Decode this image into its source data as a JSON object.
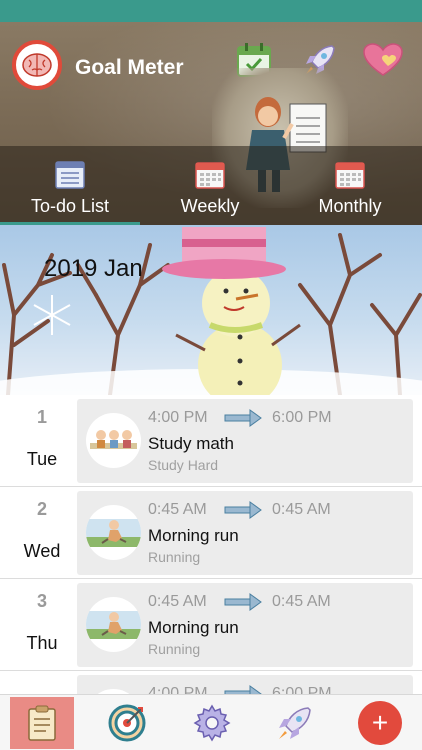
{
  "app": {
    "title": "Goal Meter",
    "colors": {
      "accent": "#3a9a8c",
      "brand_red": "#e24a3d",
      "active_nav": "#e98b85"
    }
  },
  "header": {
    "icons": [
      "calendar-check-icon",
      "rocket-icon",
      "heart-icon"
    ]
  },
  "tabs": [
    {
      "label": "To-do List",
      "icon": "checklist-icon",
      "active": true
    },
    {
      "label": "Weekly",
      "icon": "calendar-icon",
      "active": false
    },
    {
      "label": "Monthly",
      "icon": "calendar-icon",
      "active": false
    }
  ],
  "banner": {
    "month_label": "2019  Jan"
  },
  "entries": [
    {
      "day_num": "1",
      "day_name": "Tue",
      "start": "4:00 PM",
      "end": "6:00 PM",
      "title": "Study math",
      "subtitle": "Study Hard"
    },
    {
      "day_num": "2",
      "day_name": "Wed",
      "start": "0:45 AM",
      "end": "0:45 AM",
      "title": "Morning run",
      "subtitle": "Running"
    },
    {
      "day_num": "3",
      "day_name": "Thu",
      "start": "0:45 AM",
      "end": "0:45 AM",
      "title": "Morning run",
      "subtitle": "Running"
    },
    {
      "day_num": "",
      "day_name": "",
      "start": "4:00 PM",
      "end": "6:00 PM",
      "title": "",
      "subtitle": ""
    }
  ],
  "bottom_nav": [
    {
      "icon": "clipboard-icon",
      "active": true
    },
    {
      "icon": "target-icon",
      "active": false
    },
    {
      "icon": "gear-icon",
      "active": false
    },
    {
      "icon": "rocket-icon",
      "active": false
    },
    {
      "icon": "add-icon",
      "label": "+",
      "active": false
    }
  ]
}
